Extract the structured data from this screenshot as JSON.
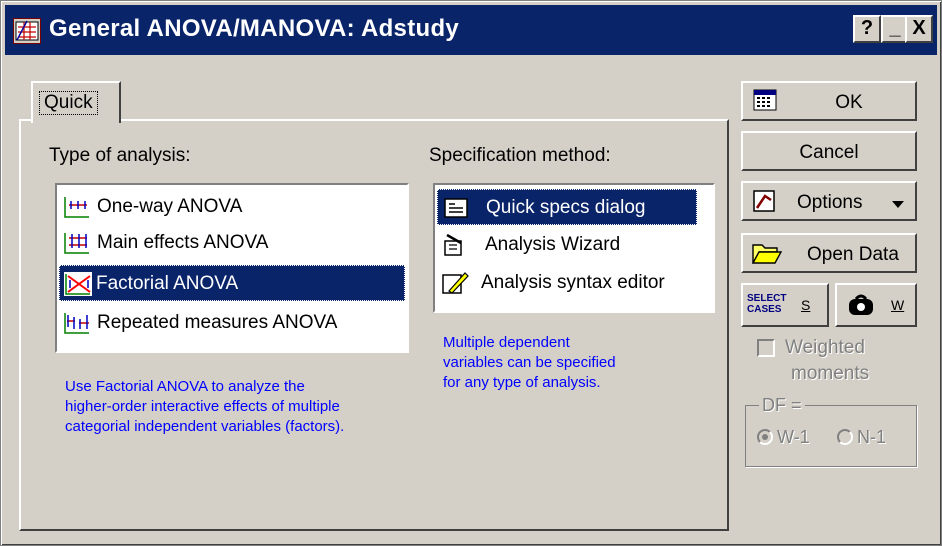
{
  "window": {
    "title": "General ANOVA/MANOVA: Adstudy",
    "help_label": "?",
    "minimize_label": "_",
    "close_label": "X"
  },
  "tabs": [
    {
      "label": "Quick"
    }
  ],
  "analysis": {
    "label": "Type of analysis:",
    "items": [
      {
        "label": "One-way ANOVA",
        "icon": "one-way-anova-icon"
      },
      {
        "label": "Main effects ANOVA",
        "icon": "main-effects-icon"
      },
      {
        "label": "Factorial ANOVA",
        "icon": "factorial-icon",
        "selected": true
      },
      {
        "label": "Repeated measures ANOVA",
        "icon": "repeated-measures-icon"
      }
    ],
    "info": [
      "Use Factorial ANOVA to analyze the",
      "higher-order interactive effects of multiple",
      "categorial independent variables (factors)."
    ]
  },
  "specification": {
    "label": "Specification method:",
    "items": [
      {
        "label": "Quick specs dialog",
        "icon": "dialog-icon",
        "selected": true
      },
      {
        "label": "Analysis Wizard",
        "icon": "wizard-icon"
      },
      {
        "label": "Analysis syntax editor",
        "icon": "pencil-icon"
      }
    ],
    "info": [
      "Multiple dependent",
      "variables can be specified",
      "for any type of analysis."
    ]
  },
  "buttons": {
    "ok": "OK",
    "cancel": "Cancel",
    "options": "Options",
    "open_data": "Open Data",
    "select_cases_icon": "SELECT CASES",
    "select_cases_s": "S",
    "weight_w": "W"
  },
  "weighted_moments": {
    "label_line1": "Weighted",
    "label_line2": "moments",
    "checked": false
  },
  "df": {
    "label": "DF =",
    "options": [
      {
        "label": "W-1",
        "selected": true
      },
      {
        "label": "N-1",
        "selected": false
      }
    ]
  },
  "colors": {
    "titlebar": "#0a246a",
    "selection": "#0a246a",
    "face": "#d4d0c8",
    "info_text": "#0000ff"
  }
}
